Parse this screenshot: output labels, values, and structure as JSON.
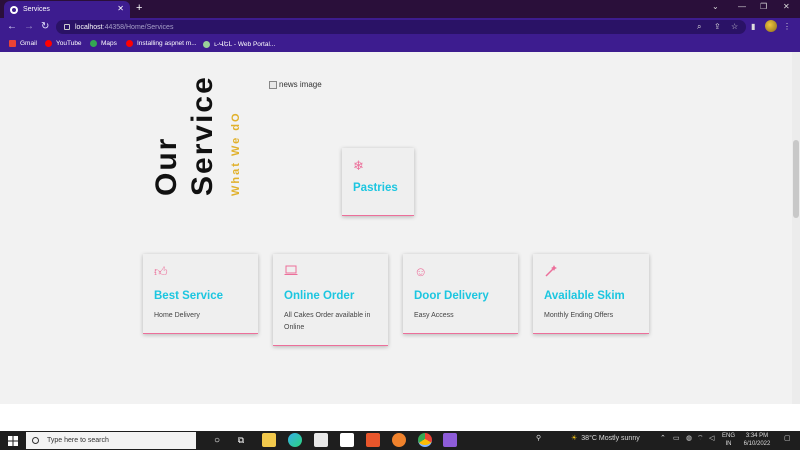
{
  "browser": {
    "tab_title": "Services",
    "new_tab": "+",
    "address_host": "localhost",
    "address_path": ":44358/Home/Services",
    "bookmarks": [
      "Gmail",
      "YouTube",
      "Maps",
      "Installing aspnet m...",
      "ւ-ՎԵԼ - Web Portal..."
    ]
  },
  "page": {
    "heading_line1": "Our",
    "heading_line2": "Service",
    "subheading": "What We dO",
    "image_alt": "news image",
    "featured_card": {
      "icon": "snowflake-icon",
      "title": "Pastries"
    },
    "cards": [
      {
        "icon": "thumbs-up-icon",
        "title": "Best Service",
        "desc": "Home Delivery"
      },
      {
        "icon": "laptop-icon",
        "title": "Online Order",
        "desc": "All Cakes Order available in Online"
      },
      {
        "icon": "smile-icon",
        "title": "Door Delivery",
        "desc": "Easy Access"
      },
      {
        "icon": "magic-wand-icon",
        "title": "Available Skim",
        "desc": "Monthly Ending Offers"
      }
    ],
    "accent_color": "#ec6f9a",
    "title_color": "#1cc6e0",
    "sub_color": "#e1b12c"
  },
  "taskbar": {
    "search_placeholder": "Type here to search",
    "weather": "38°C  Mostly sunny",
    "lang_line1": "ENG",
    "lang_line2": "IN",
    "time": "3:34 PM",
    "date": "6/10/2022"
  }
}
